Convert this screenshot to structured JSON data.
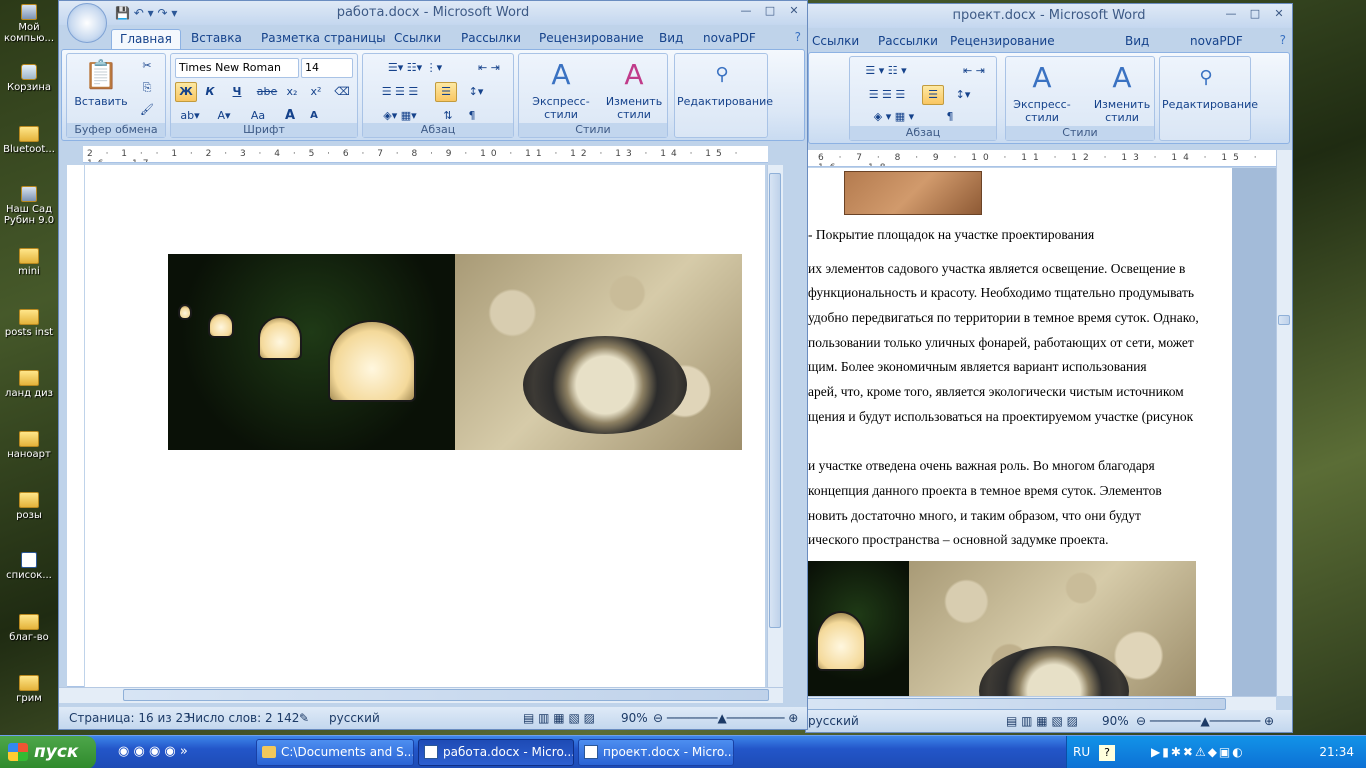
{
  "desktop": {
    "icons": [
      "Мой компью...",
      "Корзина",
      "Bluetoot...",
      "Наш Сад Рубин 9.0",
      "mini",
      "posts inst",
      "ланд диз",
      "наноарт",
      "розы",
      "список...",
      "благ-во",
      "грим"
    ]
  },
  "left_window": {
    "title": "работа.docx - Microsoft Word",
    "tabs": [
      "Главная",
      "Вставка",
      "Разметка страницы",
      "Ссылки",
      "Рассылки",
      "Рецензирование",
      "Вид",
      "novaPDF"
    ],
    "ribbon": {
      "paste": "Вставить",
      "clipboard": "Буфер обмена",
      "font_name": "Times New Roman",
      "font_size": "14",
      "font_group": "Шрифт",
      "paragraph_group": "Абзац",
      "styles_group": "Стили",
      "quick_styles": "Экспресс-стили",
      "change_styles": "Изменить стили",
      "editing": "Редактирование",
      "bold": "Ж",
      "italic": "К",
      "underline": "Ч",
      "strike": "abe",
      "sub": "x₂",
      "sup": "x²",
      "grow": "A",
      "shrink": "A",
      "case": "Aa",
      "pilcrow": "¶"
    },
    "status": {
      "page": "Страница: 16 из 23",
      "words": "Число слов: 2 142",
      "lang": "русский",
      "zoom": "90%"
    }
  },
  "right_window": {
    "title": "проект.docx - Microsoft Word",
    "tabs": [
      "Ссылки",
      "Рассылки",
      "Рецензирование",
      "Вид",
      "novaPDF"
    ],
    "ribbon": {
      "paragraph_group": "Абзац",
      "styles_group": "Стили",
      "quick_styles": "Экспресс-стили",
      "change_styles": "Изменить стили",
      "editing": "Редактирование",
      "pilcrow": "¶"
    },
    "doc_lines": [
      "- Покрытие площадок на участке проектирования",
      "их элементов садового участка является освещение. Освещение в",
      "функциональность и красоту. Необходимо тщательно продумывать",
      "удобно передвигаться по территории в темное время суток. Однако,",
      "пользовании только уличных фонарей, работающих от сети, может",
      "щим. Более экономичным является вариант использования",
      "арей, что, кроме того, является экологически чистым источником",
      "щения и будут использоваться на проектируемом участке (рисунок",
      "",
      "и участке отведена очень важная роль. Во многом благодаря",
      "концепция данного проекта в темное время суток. Элементов",
      "новить достаточно много, и таким образом, что они будут",
      "ического пространства – основной задумке проекта."
    ],
    "status": {
      "lang": "русский",
      "zoom": "90%"
    }
  },
  "taskbar": {
    "start": "пуск",
    "buttons": [
      "C:\\Documents and S...",
      "работа.docx - Micro...",
      "проект.docx - Micro..."
    ],
    "lang": "RU",
    "time": "21:34"
  }
}
